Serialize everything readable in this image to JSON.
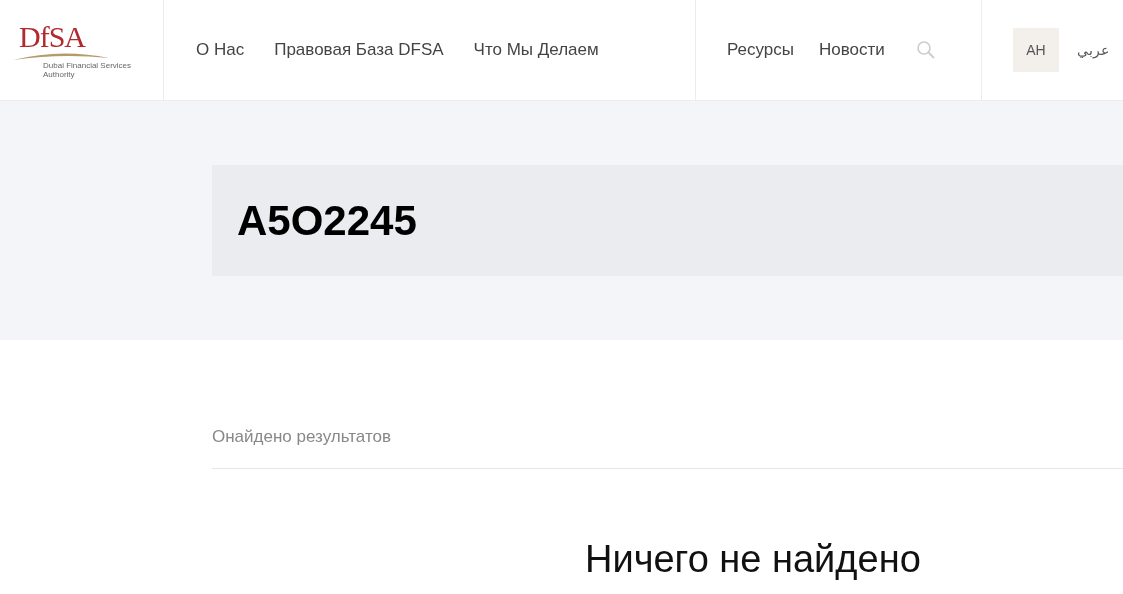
{
  "logo": {
    "mark": "DfSA",
    "caption": "Dubai Financial Services Authority"
  },
  "nav": [
    {
      "label": "О Нас"
    },
    {
      "label": "Правовая База DFSA"
    },
    {
      "label": "Что Мы Делаем"
    }
  ],
  "nav_secondary": [
    {
      "label": "Ресурсы"
    },
    {
      "label": "Новости"
    }
  ],
  "languages": [
    {
      "label": "AH",
      "selected": true
    },
    {
      "label": "عربي",
      "selected": false
    }
  ],
  "search_title": "A5O2245",
  "results_count": "Онайдено результатов",
  "empty_message": "Ничего не найдено"
}
